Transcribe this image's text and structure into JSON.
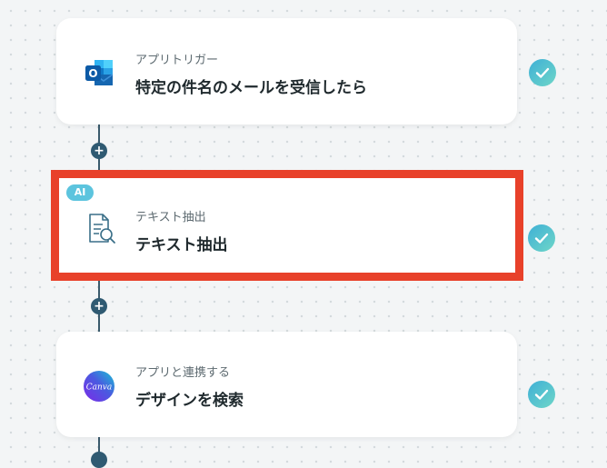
{
  "flow": {
    "steps": [
      {
        "subtitle": "アプリトリガー",
        "title": "特定の件名のメールを受信したら",
        "icon": "outlook-icon",
        "status": "completed"
      },
      {
        "badge": "AI",
        "subtitle": "テキスト抽出",
        "title": "テキスト抽出",
        "icon": "document-search-icon",
        "status": "completed"
      },
      {
        "subtitle": "アプリと連携する",
        "title": "デザインを検索",
        "icon": "canva-icon",
        "icon_label": "Canva",
        "status": "completed"
      }
    ],
    "add_step_symbol": "+"
  },
  "colors": {
    "highlight": "#e8412a",
    "connector": "#3a5a6c",
    "check_gradient_start": "#3fb0d6",
    "check_gradient_end": "#6ed6c8",
    "ai_badge": "#5cc4de"
  }
}
